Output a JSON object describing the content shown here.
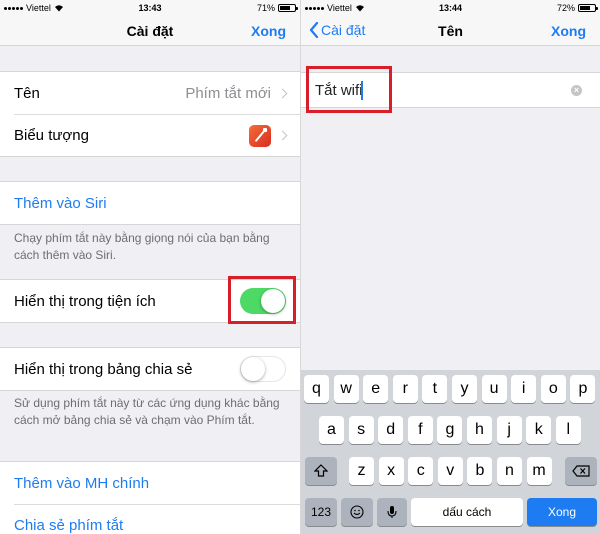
{
  "left": {
    "status": {
      "carrier": "Viettel",
      "time": "13:43",
      "battery": "71%",
      "battery_level": 0.71
    },
    "nav": {
      "title": "Cài đặt",
      "done": "Xong"
    },
    "name_row": {
      "label": "Tên",
      "value": "Phím tắt mới"
    },
    "icon_row": {
      "label": "Biểu tượng",
      "icon": "magic-wand-shortcut-icon"
    },
    "add_siri": {
      "label": "Thêm vào Siri",
      "footer": "Chạy phím tắt này bằng giọng nói của bạn bằng cách thêm vào Siri."
    },
    "widget_row": {
      "label": "Hiển thị trong tiện ích",
      "on": true
    },
    "share_row": {
      "label": "Hiển thị trong bảng chia sẻ",
      "on": false,
      "footer": "Sử dụng phím tắt này từ các ứng dụng khác bằng cách mở bảng chia sẻ và chạm vào Phím tắt."
    },
    "add_home": {
      "label": "Thêm vào MH chính"
    },
    "share_shortcut": {
      "label": "Chia sẻ phím tắt"
    }
  },
  "right": {
    "status": {
      "carrier": "Viettel",
      "time": "13:44",
      "battery": "72%",
      "battery_level": 0.72
    },
    "nav": {
      "back": "Cài đặt",
      "title": "Tên",
      "done": "Xong"
    },
    "name_field": {
      "value": "Tắt wifi"
    },
    "keyboard": {
      "row1": [
        "q",
        "w",
        "e",
        "r",
        "t",
        "y",
        "u",
        "i",
        "o",
        "p"
      ],
      "row2": [
        "a",
        "s",
        "d",
        "f",
        "g",
        "h",
        "j",
        "k",
        "l"
      ],
      "row3": [
        "z",
        "x",
        "c",
        "v",
        "b",
        "n",
        "m"
      ],
      "numbers": "123",
      "space": "dấu cách",
      "return": "Xong"
    }
  },
  "colors": {
    "accent": "#1e7cf2",
    "toggle_on": "#4cd964",
    "highlight": "#d81e2a"
  }
}
